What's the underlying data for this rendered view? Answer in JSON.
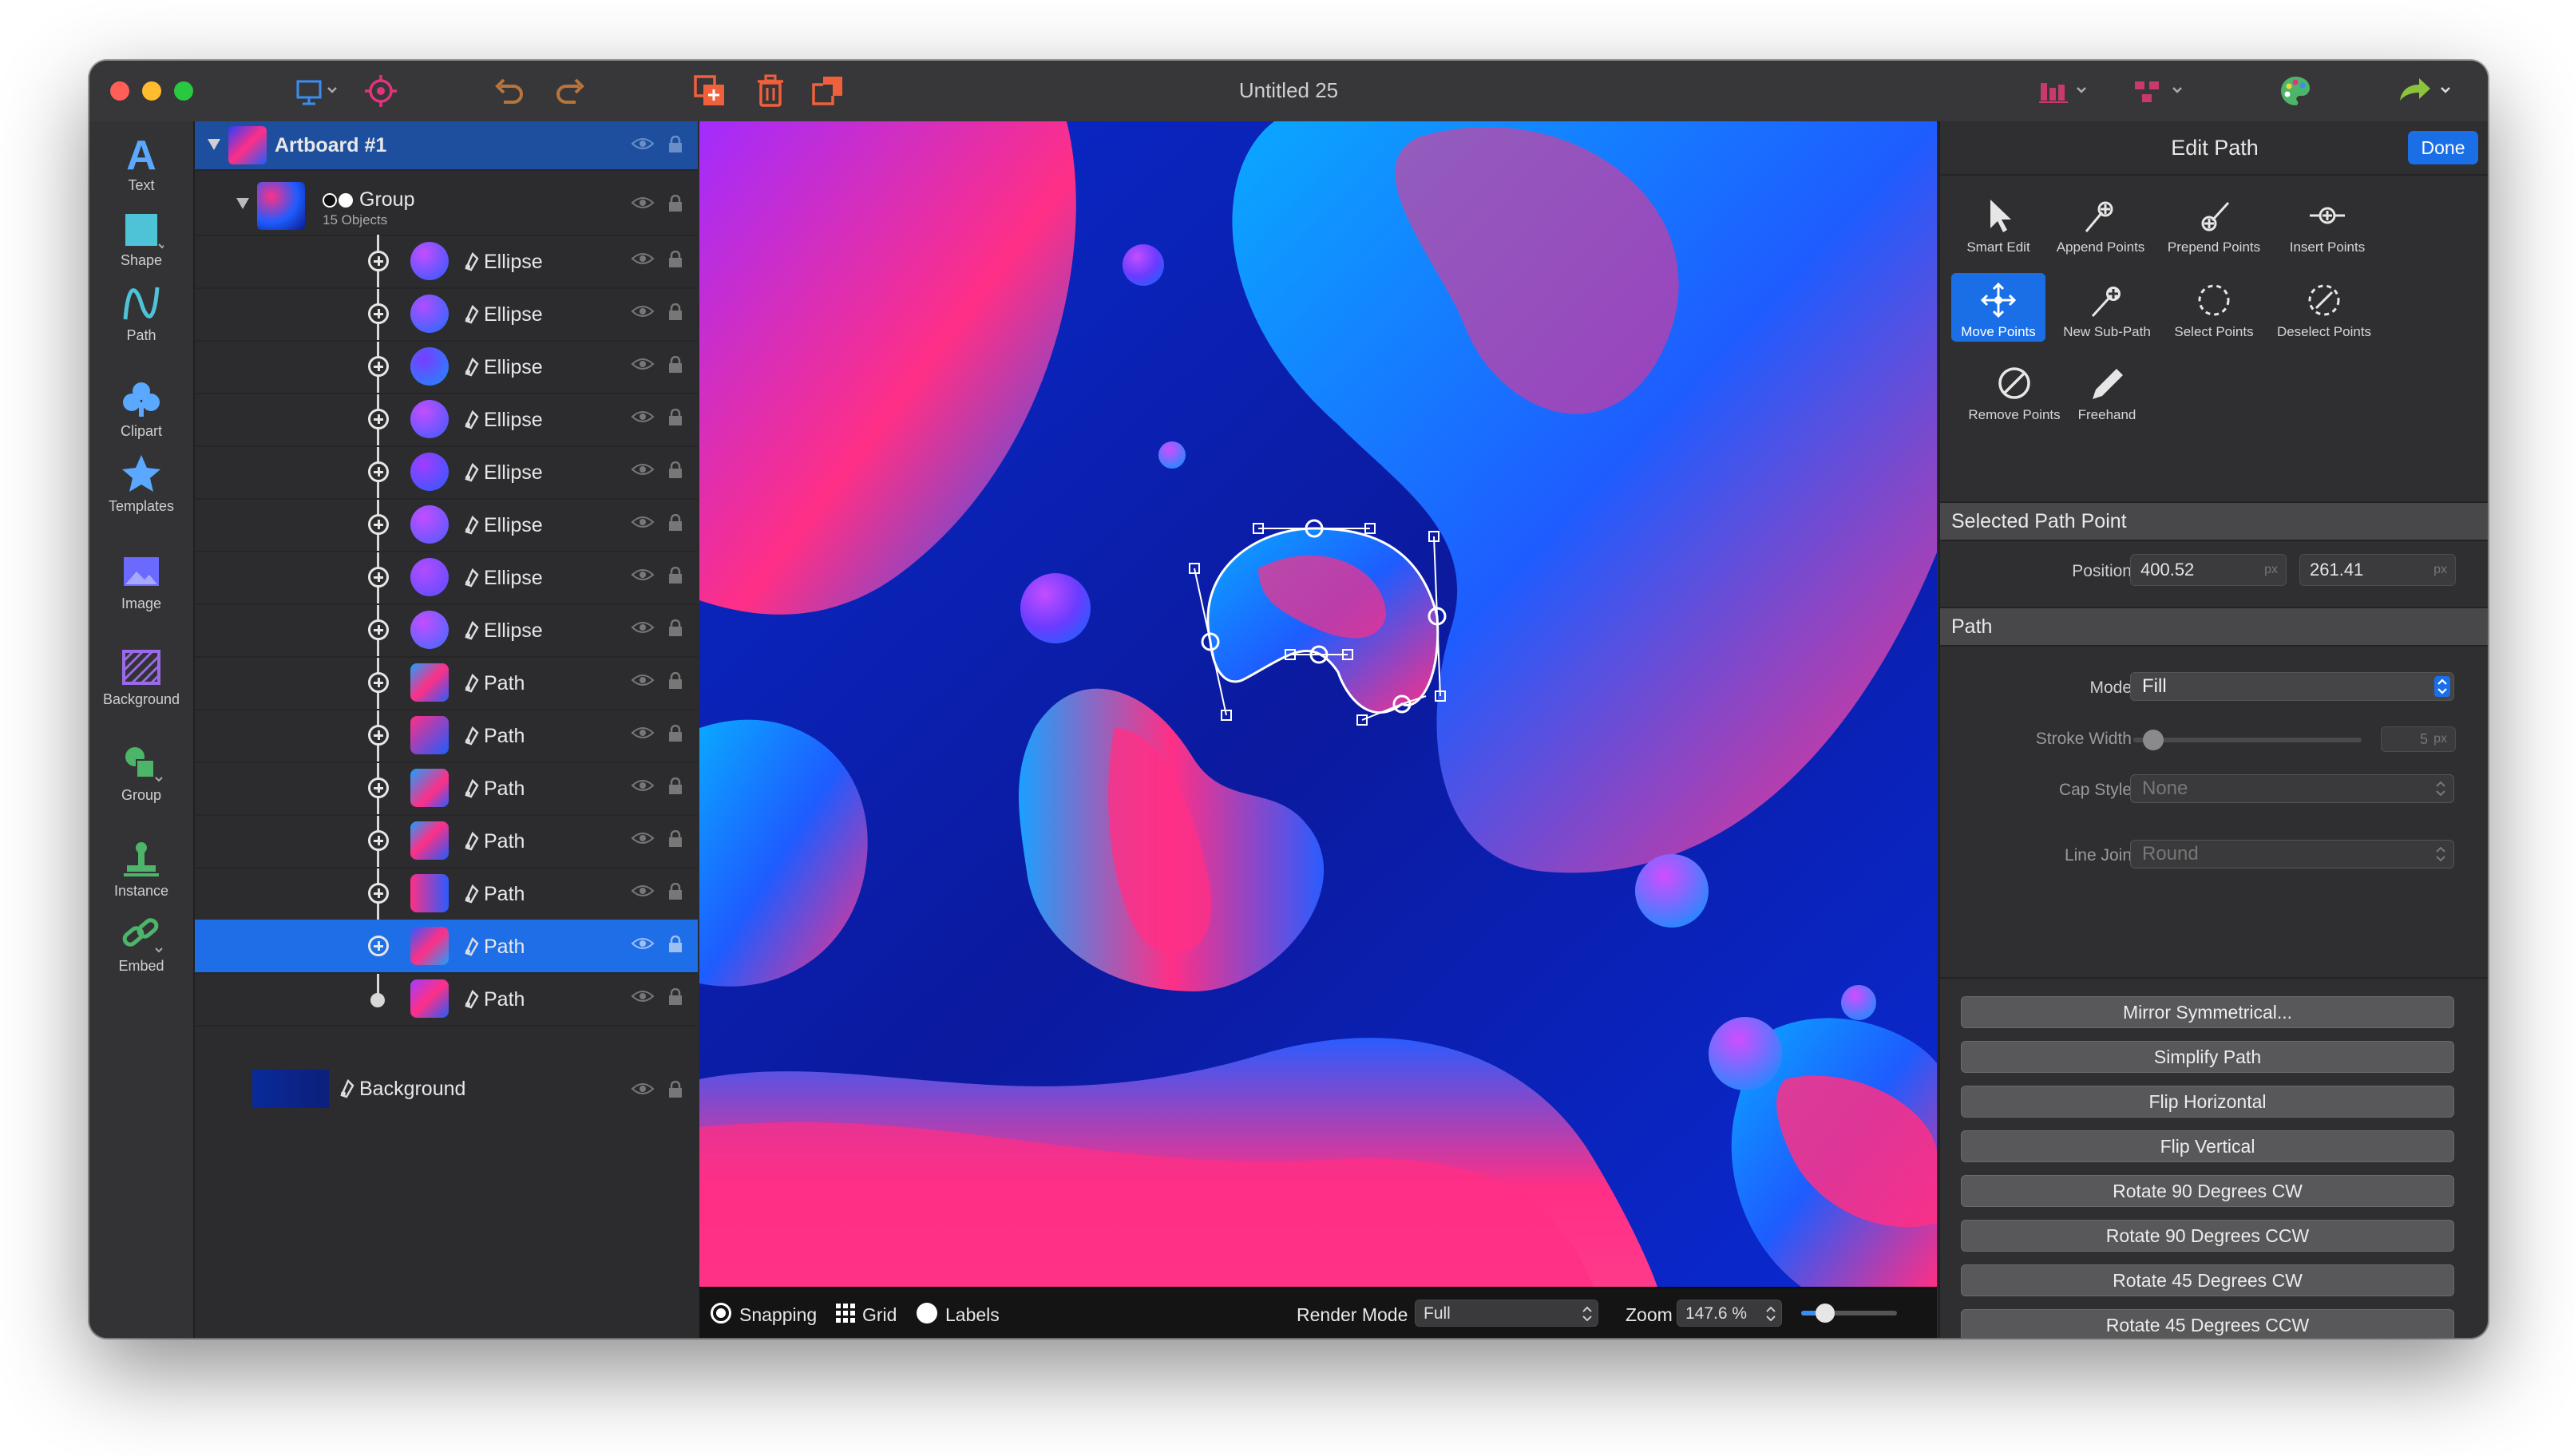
{
  "window": {
    "title": "Untitled 25"
  },
  "tools": [
    {
      "name": "tool-text",
      "label": "Text"
    },
    {
      "name": "tool-shape",
      "label": "Shape"
    },
    {
      "name": "tool-path",
      "label": "Path"
    },
    {
      "name": "tool-clipart",
      "label": "Clipart"
    },
    {
      "name": "tool-templates",
      "label": "Templates"
    },
    {
      "name": "tool-image",
      "label": "Image"
    },
    {
      "name": "tool-background",
      "label": "Background"
    },
    {
      "name": "tool-group",
      "label": "Group"
    },
    {
      "name": "tool-instance",
      "label": "Instance"
    },
    {
      "name": "tool-embed",
      "label": "Embed"
    }
  ],
  "layers": {
    "artboard": "Artboard #1",
    "group": {
      "label": "Group",
      "count": "15 Objects"
    },
    "items": [
      {
        "label": "Ellipse",
        "selected": false
      },
      {
        "label": "Ellipse",
        "selected": false
      },
      {
        "label": "Ellipse",
        "selected": false
      },
      {
        "label": "Ellipse",
        "selected": false
      },
      {
        "label": "Ellipse",
        "selected": false
      },
      {
        "label": "Ellipse",
        "selected": false
      },
      {
        "label": "Ellipse",
        "selected": false
      },
      {
        "label": "Ellipse",
        "selected": false
      },
      {
        "label": "Path",
        "selected": false
      },
      {
        "label": "Path",
        "selected": false
      },
      {
        "label": "Path",
        "selected": false
      },
      {
        "label": "Path",
        "selected": false
      },
      {
        "label": "Path",
        "selected": false
      },
      {
        "label": "Path",
        "selected": true
      },
      {
        "label": "Path",
        "selected": false
      }
    ],
    "background": "Background"
  },
  "statusbar": {
    "snapping": "Snapping",
    "grid": "Grid",
    "labels": "Labels",
    "render_mode_label": "Render Mode",
    "render_mode_value": "Full",
    "zoom_label": "Zoom",
    "zoom_value": "147.6 %",
    "zoom_level": 0.25
  },
  "inspector": {
    "title": "Edit Path",
    "done": "Done",
    "path_tools": [
      {
        "name": "smart-edit",
        "label": "Smart Edit",
        "active": false
      },
      {
        "name": "append-points",
        "label": "Append Points",
        "active": false
      },
      {
        "name": "prepend-points",
        "label": "Prepend Points",
        "active": false
      },
      {
        "name": "insert-points",
        "label": "Insert Points",
        "active": false
      },
      {
        "name": "move-points",
        "label": "Move Points",
        "active": true
      },
      {
        "name": "new-sub-path",
        "label": "New Sub-Path",
        "active": false
      },
      {
        "name": "select-points",
        "label": "Select Points",
        "active": false
      },
      {
        "name": "deselect-points",
        "label": "Deselect Points",
        "active": false
      },
      {
        "name": "remove-points",
        "label": "Remove Points",
        "active": false
      },
      {
        "name": "freehand",
        "label": "Freehand",
        "active": false
      }
    ],
    "selected_point": {
      "section": "Selected Path Point",
      "position_label": "Position",
      "x": "400.52",
      "y": "261.41",
      "unit": "px"
    },
    "path": {
      "section": "Path",
      "mode_label": "Mode",
      "mode_value": "Fill",
      "stroke_label": "Stroke Width",
      "stroke_value": "5",
      "stroke_unit": "px",
      "stroke_level": 0.05,
      "cap_label": "Cap Style",
      "cap_value": "None",
      "join_label": "Line Join",
      "join_value": "Round"
    },
    "actions": [
      "Mirror Symmetrical...",
      "Simplify Path",
      "Flip Horizontal",
      "Flip Vertical",
      "Rotate 90 Degrees CW",
      "Rotate 90 Degrees CCW",
      "Rotate 45 Degrees CW",
      "Rotate 45 Degrees CCW"
    ]
  },
  "colors": {
    "accent": "#1a6fe6",
    "selection": "#1e6ee8",
    "magenta": "#ff2f86",
    "blue": "#1e5cff",
    "violet": "#a43cff"
  }
}
